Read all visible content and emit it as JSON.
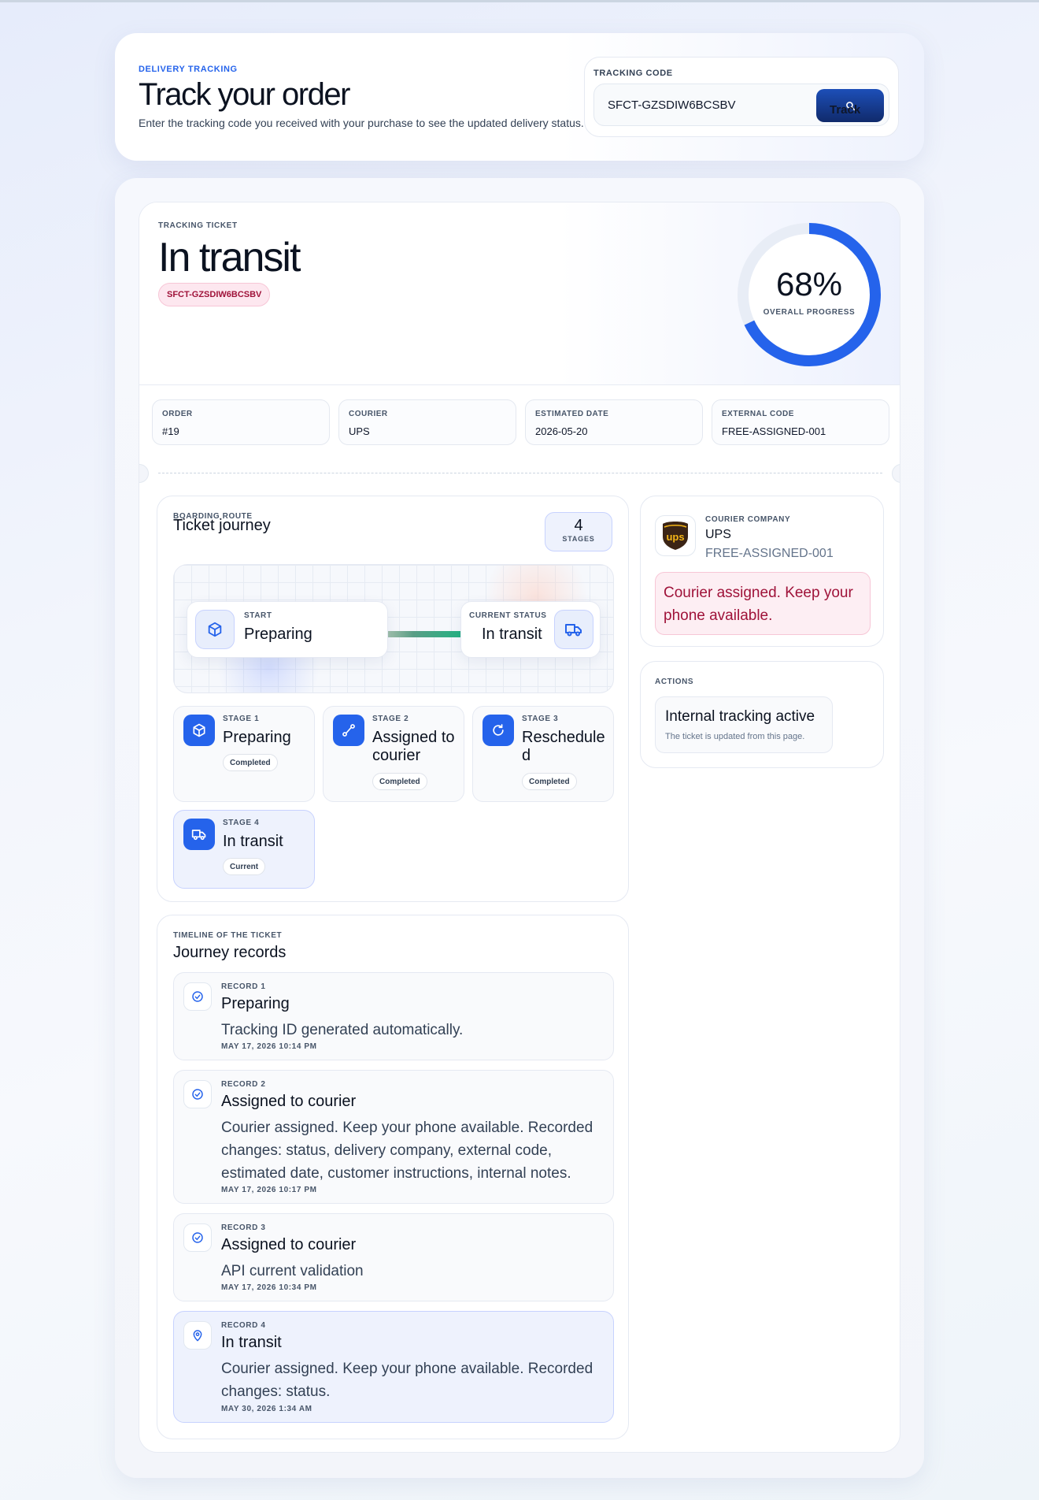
{
  "header": {
    "eyebrow": "DELIVERY TRACKING",
    "title": "Track your order",
    "subtitle": "Enter the tracking code you received with your purchase to see the updated delivery status.",
    "tracking_label": "TRACKING CODE",
    "tracking_value": "SFCT-GZSDIW6BCSBV",
    "track_button": "Track"
  },
  "ticket": {
    "eyebrow": "TRACKING TICKET",
    "status": "In transit",
    "code": "SFCT-GZSDIW6BCSBV",
    "progress_text": "68%",
    "progress": 0.68,
    "progress_label": "OVERALL PROGRESS",
    "meta": [
      {
        "label": "ORDER",
        "value": "#19"
      },
      {
        "label": "COURIER",
        "value": "UPS"
      },
      {
        "label": "ESTIMATED DATE",
        "value": "2026-05-20"
      },
      {
        "label": "EXTERNAL CODE",
        "value": "FREE-ASSIGNED-001"
      }
    ]
  },
  "journey": {
    "eyebrow": "BOARDING ROUTE",
    "title": "Ticket journey",
    "stage_count": "4",
    "stage_count_label": "STAGES",
    "start_label": "START",
    "start_value": "Preparing",
    "current_label": "CURRENT STATUS",
    "current_value": "In transit",
    "stages": [
      {
        "label": "STAGE 1",
        "title": "Preparing",
        "badge": "Completed",
        "icon": "box-icon"
      },
      {
        "label": "STAGE 2",
        "title": "Assigned to courier",
        "badge": "Completed",
        "icon": "route-icon"
      },
      {
        "label": "STAGE 3",
        "title": "Rescheduled",
        "badge": "Completed",
        "icon": "refresh-icon"
      },
      {
        "label": "STAGE 4",
        "title": "In transit",
        "badge": "Current",
        "icon": "truck-icon"
      }
    ]
  },
  "courier": {
    "eyebrow": "COURIER COMPANY",
    "name": "UPS",
    "code": "FREE-ASSIGNED-001",
    "logo_text": "ups",
    "message": "Courier assigned. Keep your phone available."
  },
  "actions": {
    "eyebrow": "ACTIONS",
    "title": "Internal tracking active",
    "subtitle": "The ticket is updated from this page."
  },
  "timeline": {
    "eyebrow": "TIMELINE OF THE TICKET",
    "title": "Journey records",
    "records": [
      {
        "label": "RECORD 1",
        "title": "Preparing",
        "desc": "Tracking ID generated automatically.",
        "time": "MAY 17, 2026 10:14 PM",
        "icon": "check-circle-icon"
      },
      {
        "label": "RECORD 2",
        "title": "Assigned to courier",
        "desc": "Courier assigned. Keep your phone available. Recorded changes: status, delivery company, external code, estimated date, customer instructions, internal notes.",
        "time": "MAY 17, 2026 10:17 PM",
        "icon": "check-circle-icon"
      },
      {
        "label": "RECORD 3",
        "title": "Assigned to courier",
        "desc": "API current validation",
        "time": "MAY 17, 2026 10:34 PM",
        "icon": "check-circle-icon"
      },
      {
        "label": "RECORD 4",
        "title": "In transit",
        "desc": "Courier assigned. Keep your phone available. Recorded changes: status.",
        "time": "MAY 30, 2026 1:34 AM",
        "icon": "map-pin-icon"
      }
    ]
  },
  "colors": {
    "accent": "#2563eb",
    "alert_text": "#9f1239",
    "alert_bg": "#fdeef3"
  }
}
